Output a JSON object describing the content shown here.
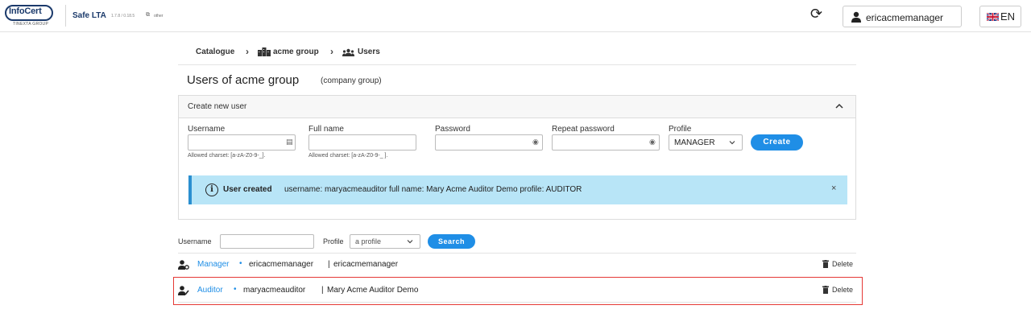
{
  "header": {
    "logo_text": "InfoCert",
    "logo_sub": "TINEXTA GROUP",
    "app_name": "Safe LTA",
    "app_version": "1.7.8 / 0.18.5",
    "other_label": "other",
    "user_name": "ericacmemanager",
    "language": "EN",
    "refresh_icon": "refresh-icon",
    "user_icon": "user-icon"
  },
  "breadcrumb": {
    "items": [
      "Catalogue",
      "acme group",
      "Users"
    ]
  },
  "page": {
    "title": "Users of acme group",
    "subtitle": "(company group)"
  },
  "create_panel": {
    "title": "Create new user",
    "username_label": "Username",
    "fullname_label": "Full name",
    "password_label": "Password",
    "repeat_password_label": "Repeat password",
    "profile_label": "Profile",
    "profile_value": "MANAGER",
    "username_hint": "Allowed charset: [a-zA-Z0-9-_].",
    "fullname_hint": "Allowed charset: [a-zA-Z0-9-_ ].",
    "create_label": "Create"
  },
  "alert": {
    "strong": "User created",
    "text": "username: maryacmeauditor full name: Mary Acme Auditor Demo profile: AUDITOR",
    "close": "×"
  },
  "search": {
    "username_label": "Username",
    "profile_label": "Profile",
    "profile_placeholder": "a profile",
    "button_label": "Search"
  },
  "users": [
    {
      "role": "Manager",
      "username": "ericacmemanager",
      "full_name": "ericacmemanager",
      "delete_label": "Delete"
    },
    {
      "role": "Auditor",
      "username": "maryacmeauditor",
      "full_name": "Mary Acme Auditor Demo",
      "delete_label": "Delete"
    }
  ],
  "colors": {
    "accent": "#1f8ee6",
    "alert_bg": "#b8e5f7",
    "highlight": "#e53935",
    "brand": "#1b3a6b"
  }
}
